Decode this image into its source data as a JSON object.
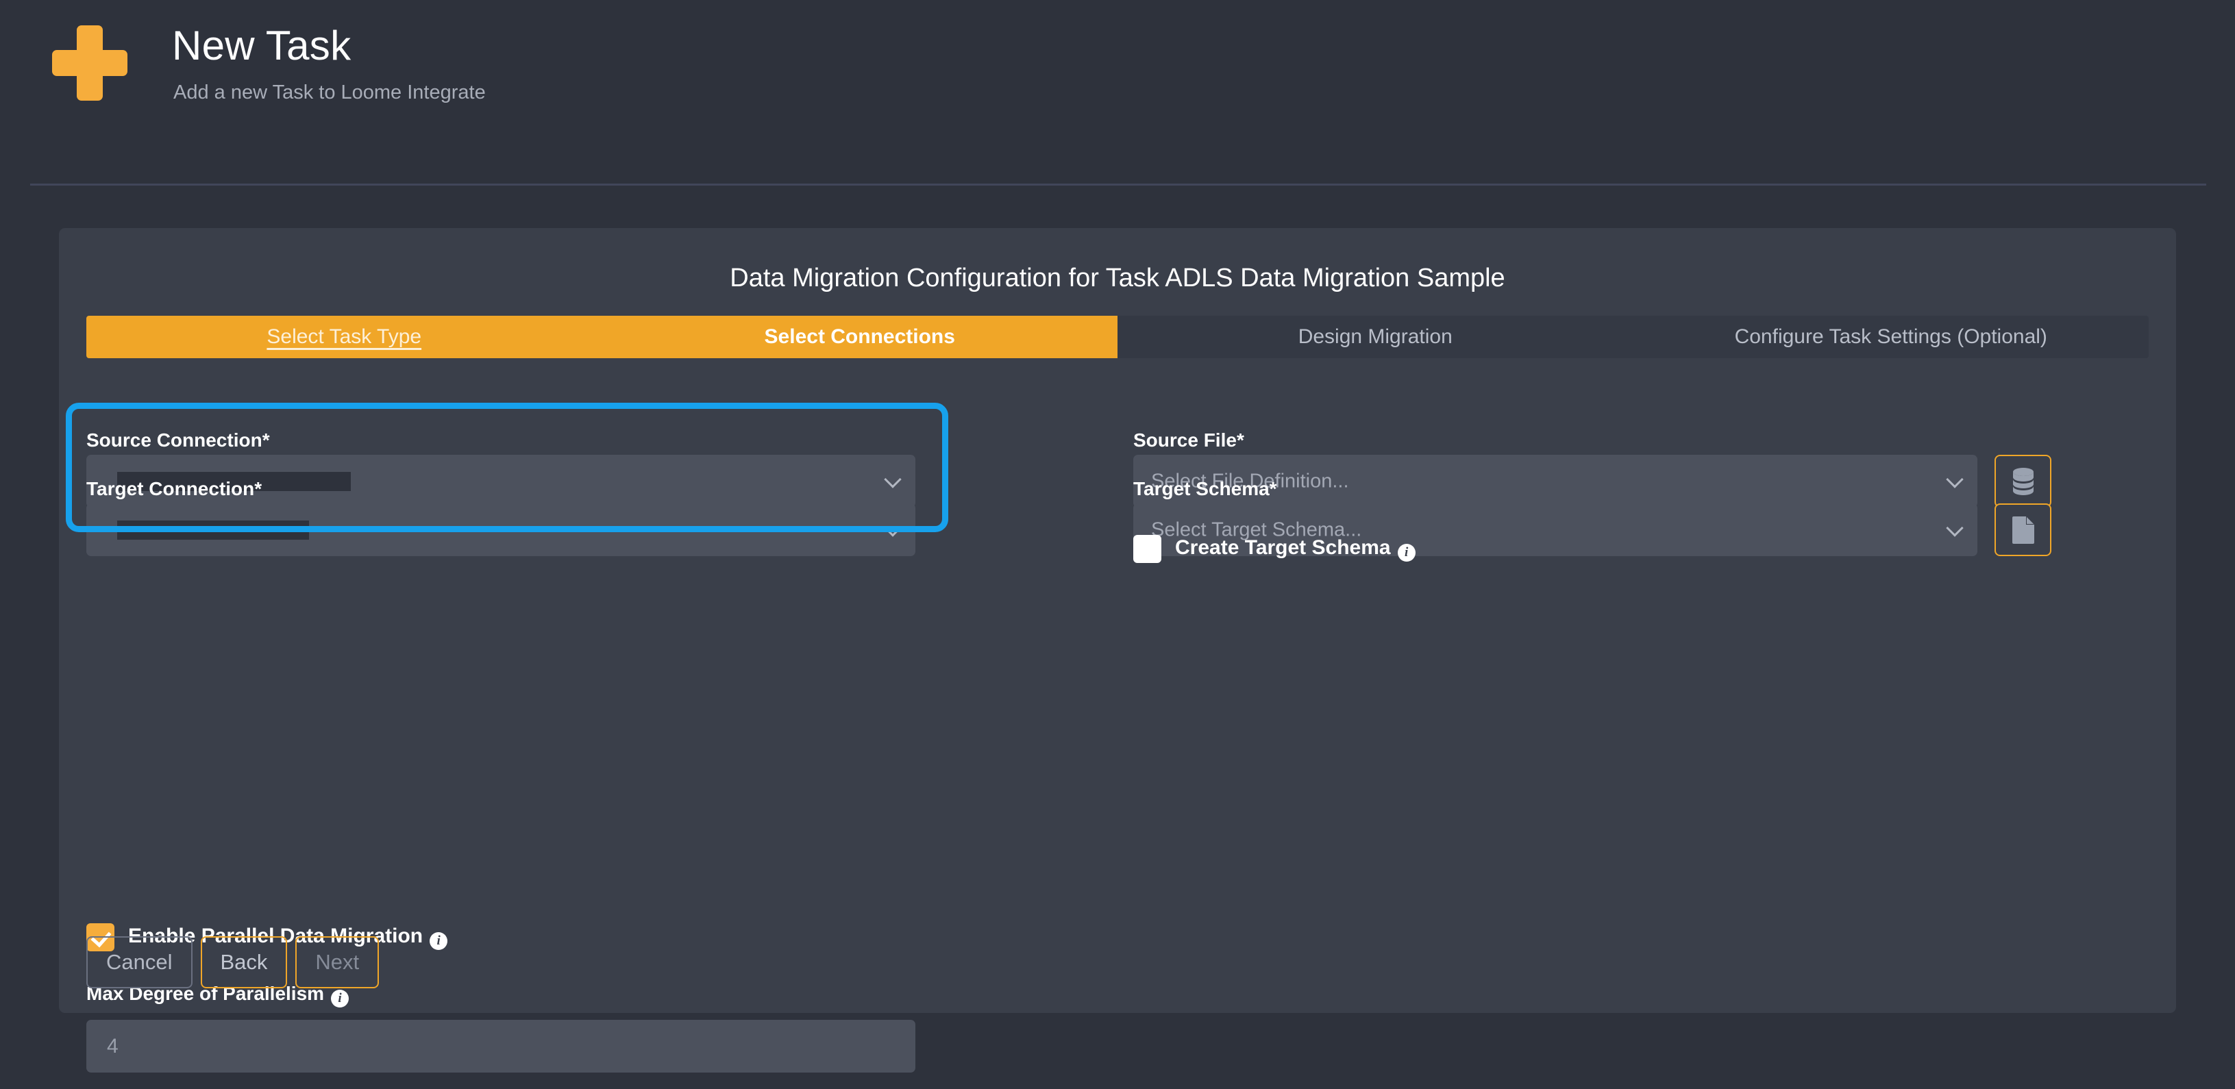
{
  "header": {
    "icon": "plus-icon",
    "title": "New Task",
    "subtitle": "Add a new Task to Loome Integrate"
  },
  "card": {
    "title": "Data Migration Configuration for Task ADLS Data Migration Sample",
    "tabs": [
      {
        "label": "Select Task Type",
        "state": "done"
      },
      {
        "label": "Select Connections",
        "state": "current"
      },
      {
        "label": "Design Migration",
        "state": "upcoming"
      },
      {
        "label": "Configure Task Settings (Optional)",
        "state": "upcoming"
      }
    ]
  },
  "form": {
    "source_connection": {
      "label": "Source Connection*",
      "value": "",
      "redacted": true,
      "highlighted": true
    },
    "target_connection": {
      "label": "Target Connection*",
      "value": "",
      "redacted": true
    },
    "source_file": {
      "label": "Source File*",
      "placeholder": "Select File Definition...",
      "button_icon": "database-icon"
    },
    "target_schema": {
      "label": "Target Schema*",
      "placeholder": "Select Target Schema...",
      "button_icon": "file-icon"
    },
    "create_target_schema": {
      "label": "Create Target Schema",
      "checked": false,
      "info_icon": "info-icon"
    },
    "enable_parallel": {
      "label": "Enable Parallel Data Migration",
      "checked": true,
      "info_icon": "info-icon"
    },
    "max_degree_parallelism": {
      "label": "Max Degree of Parallelism",
      "value": "4",
      "info_icon": "info-icon"
    }
  },
  "footer": {
    "cancel_label": "Cancel",
    "back_label": "Back",
    "next_label": "Next"
  },
  "colors": {
    "accent": "#f0a628",
    "highlight": "#17a1ec",
    "page_bg": "#2e323c",
    "card_bg": "#3a3f4a",
    "field_bg": "#4c515d"
  }
}
